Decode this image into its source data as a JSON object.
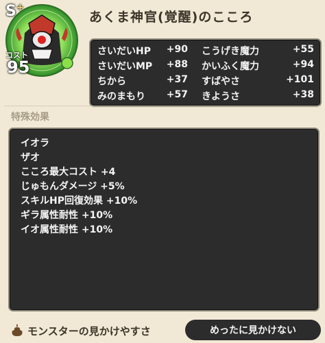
{
  "monster": {
    "rank": "S",
    "rank_plus": "+",
    "cost_label": "コスト",
    "cost": "95",
    "title": "あくま神官(覚醒)のこころ",
    "icon": "demon-priest-portrait-icon"
  },
  "stats": [
    {
      "name1": "さいだいHP",
      "val1": "+90",
      "name2": "こうげき魔力",
      "val2": "+55"
    },
    {
      "name1": "さいだいMP",
      "val1": "+88",
      "name2": "かいふく魔力",
      "val2": "+94"
    },
    {
      "name1": "ちから",
      "val1": "+37",
      "name2": "すばやさ",
      "val2": "+101"
    },
    {
      "name1": "みのまもり",
      "val1": "+57",
      "name2": "きようさ",
      "val2": "+38"
    }
  ],
  "special": {
    "label": "特殊効果",
    "effects": [
      "イオラ",
      "ザオ",
      "こころ最大コスト +4",
      "じゅもんダメージ +5%",
      "スキルHP回復効果 +10%",
      "ギラ属性耐性 +10%",
      "イオ属性耐性 +10%"
    ]
  },
  "visibility": {
    "icon": "poop-icon",
    "label": "モンスターの見かけやすさ",
    "value": "めったに見かけない"
  },
  "colors": {
    "background": "#f1e9d6",
    "panel": "#2c2c2c",
    "ring_green": "#6fd64a",
    "orb_green": "#8be04a"
  }
}
